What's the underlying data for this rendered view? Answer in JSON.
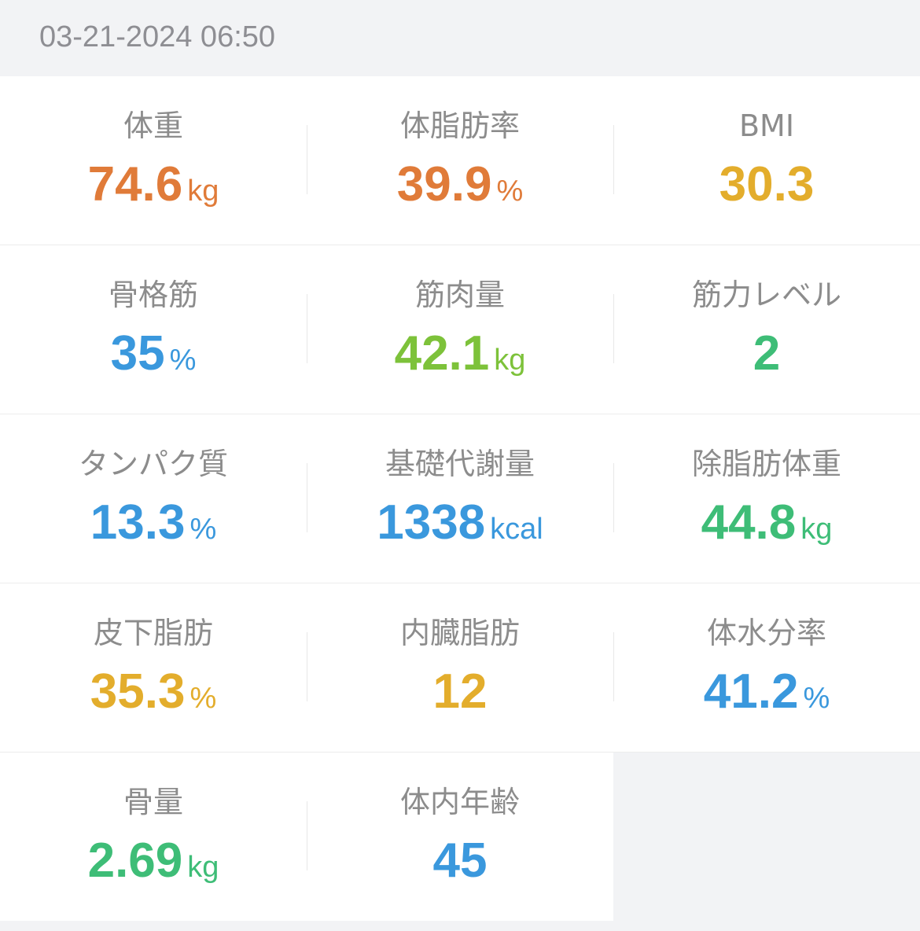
{
  "timestamp": "03-21-2024 06:50",
  "colors": {
    "orange": "#e07b39",
    "yellow": "#e3ad2c",
    "blue": "#3a98dd",
    "green": "#3ebd77",
    "lime": "#7dc23a"
  },
  "metrics": [
    {
      "label": "体重",
      "value": "74.6",
      "unit": "kg"
    },
    {
      "label": "体脂肪率",
      "value": "39.9",
      "unit": "%"
    },
    {
      "label": "BMI",
      "value": "30.3",
      "unit": ""
    },
    {
      "label": "骨格筋",
      "value": "35",
      "unit": "%"
    },
    {
      "label": "筋肉量",
      "value": "42.1",
      "unit": "kg"
    },
    {
      "label": "筋力レベル",
      "value": "2",
      "unit": ""
    },
    {
      "label": "タンパク質",
      "value": "13.3",
      "unit": "%"
    },
    {
      "label": "基礎代謝量",
      "value": "1338",
      "unit": "kcal"
    },
    {
      "label": "除脂肪体重",
      "value": "44.8",
      "unit": "kg"
    },
    {
      "label": "皮下脂肪",
      "value": "35.3",
      "unit": "%"
    },
    {
      "label": "内臓脂肪",
      "value": "12",
      "unit": ""
    },
    {
      "label": "体水分率",
      "value": "41.2",
      "unit": "%"
    },
    {
      "label": "骨量",
      "value": "2.69",
      "unit": "kg"
    },
    {
      "label": "体内年齢",
      "value": "45",
      "unit": ""
    }
  ]
}
